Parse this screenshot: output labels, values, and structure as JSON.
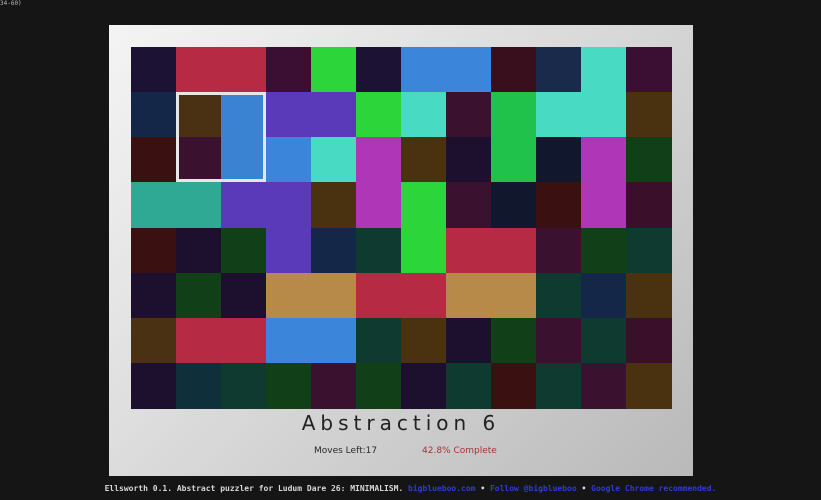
{
  "corner_tag": "34-60)",
  "level": {
    "title": "Abstraction 6"
  },
  "status": {
    "moves_left": "Moves Left:17",
    "complete": "42.8% Complete"
  },
  "footer": {
    "description": "Ellsworth 0.1. Abstract puzzler for Ludum Dare 26: MINIMALISM.",
    "site_link": "bigblueboo.com",
    "follow_link": "Follow @bigblueboo",
    "browser_note": "Google Chrome recommended.",
    "separator": "•"
  },
  "colors": {
    "A": "#1c1233",
    "B": "#b62a43",
    "C": "#3b0f34",
    "D": "#2cd63a",
    "E": "#3b85da",
    "F": "#3a0f1d",
    "G": "#1a2a4a",
    "H": "#48dac3",
    "I": "#142748",
    "J": "#4a3113",
    "K": "#5a3ab8",
    "L": "#3a1230",
    "M": "#3a1010",
    "N": "#3a83d3",
    "O": "#b036b8",
    "P": "#1c102e",
    "Q": "#113f18",
    "R": "#2fa894",
    "S": "#4a3110",
    "T": "#3a0f2a",
    "U": "#20c24c",
    "V": "#0f3a2f",
    "W": "#11182e",
    "X": "#b88a4a",
    "Y": "#28124a",
    "Z": "#1c1b4f",
    "a": "#0f2f3a",
    "b": "#2d3d20"
  },
  "board": {
    "cols": 12,
    "rows": 8,
    "grid": [
      "ABBCDAEEFGHC",
      "IJNKKDHLUHHS",
      "MLNEHOSPUWOQ",
      "RRKKSODLWMOT",
      "MPQKIVDBBLQV",
      "PQPXXBBXXVIS",
      "JBBEEVSPQLVT",
      "PaVQLQPVMVLS"
    ],
    "selected": {
      "col": 1,
      "row": 1,
      "w": 2,
      "h": 2
    }
  }
}
